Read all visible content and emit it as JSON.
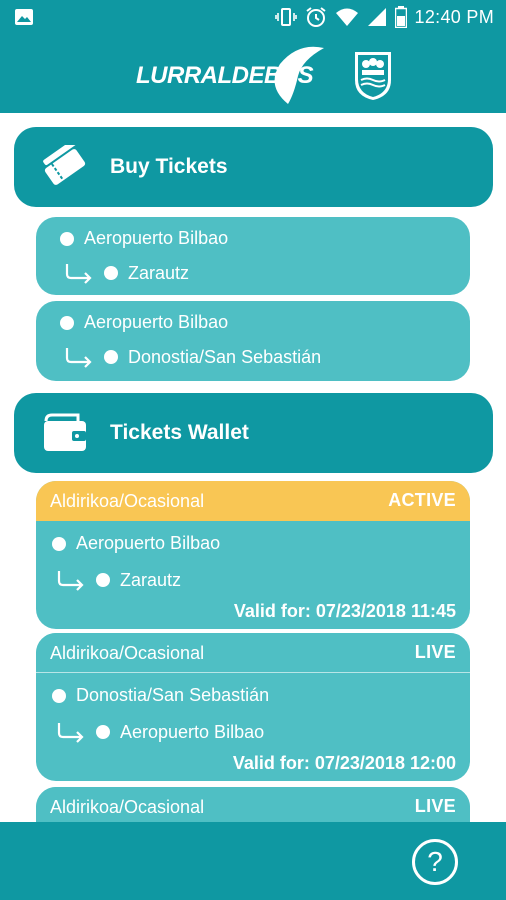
{
  "status_bar": {
    "time": "12:40 PM",
    "icons": [
      "image-icon",
      "vibrate-icon",
      "alarm-icon",
      "wifi-icon",
      "signal-icon",
      "battery-icon"
    ]
  },
  "header": {
    "logo_text": "LURRALDEBUS",
    "crest_icon": "coat-of-arms-icon"
  },
  "buy_tickets": {
    "label": "Buy Tickets",
    "icon": "tickets-icon",
    "routes": [
      {
        "from": "Aeropuerto Bilbao",
        "to": "Zarautz"
      },
      {
        "from": "Aeropuerto Bilbao",
        "to": "Donostia/San Sebastián"
      }
    ]
  },
  "tickets_wallet": {
    "label": "Tickets Wallet",
    "icon": "wallet-icon",
    "tickets": [
      {
        "type": "Aldirikoa/Ocasional",
        "status": "ACTIVE",
        "from": "Aeropuerto Bilbao",
        "to": "Zarautz",
        "valid": "Valid for: 07/23/2018 11:45"
      },
      {
        "type": "Aldirikoa/Ocasional",
        "status": "LIVE",
        "from": "Donostia/San Sebastián",
        "to": "Aeropuerto Bilbao",
        "valid": "Valid for: 07/23/2018 12:00"
      },
      {
        "type": "Aldirikoa/Ocasional",
        "status": "LIVE"
      }
    ]
  },
  "footer": {
    "help_label": "?"
  },
  "colors": {
    "primary": "#0f98a2",
    "card": "#4fbfc4",
    "active": "#f9c654"
  }
}
